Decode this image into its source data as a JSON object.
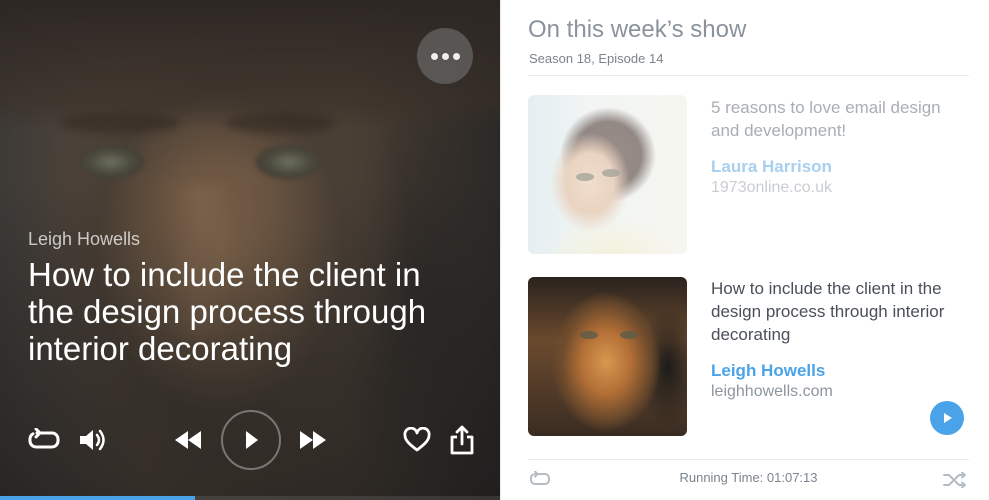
{
  "player": {
    "author": "Leigh Howells",
    "title": "How to include the client in the design process through interior decorating",
    "progress_fraction": 0.39,
    "icons": {
      "more": "more-dots-icon",
      "repeat": "repeat-icon",
      "volume": "volume-icon",
      "rewind": "rewind-icon",
      "play": "play-icon",
      "fast_forward": "fast-forward-icon",
      "like": "heart-icon",
      "share": "share-icon"
    }
  },
  "panel": {
    "title": "On this week’s show",
    "subtitle": "Season 18, Episode 14",
    "episodes": [
      {
        "title": "5 reasons to love email design and development!",
        "author": "Laura Harrison",
        "site": "1973online.co.uk",
        "state": "faded"
      },
      {
        "title": "How to include the client in the design process through interior decorating",
        "author": "Leigh Howells",
        "site": "leighhowells.com",
        "state": "active"
      }
    ],
    "footer": {
      "running_time": "Running Time: 01:07:13",
      "left_icon": "repeat-icon",
      "right_icon": "shuffle-icon"
    }
  },
  "colors": {
    "accent": "#4aa3e8",
    "text_dark": "#4a5058",
    "text_muted": "#8a939c"
  }
}
